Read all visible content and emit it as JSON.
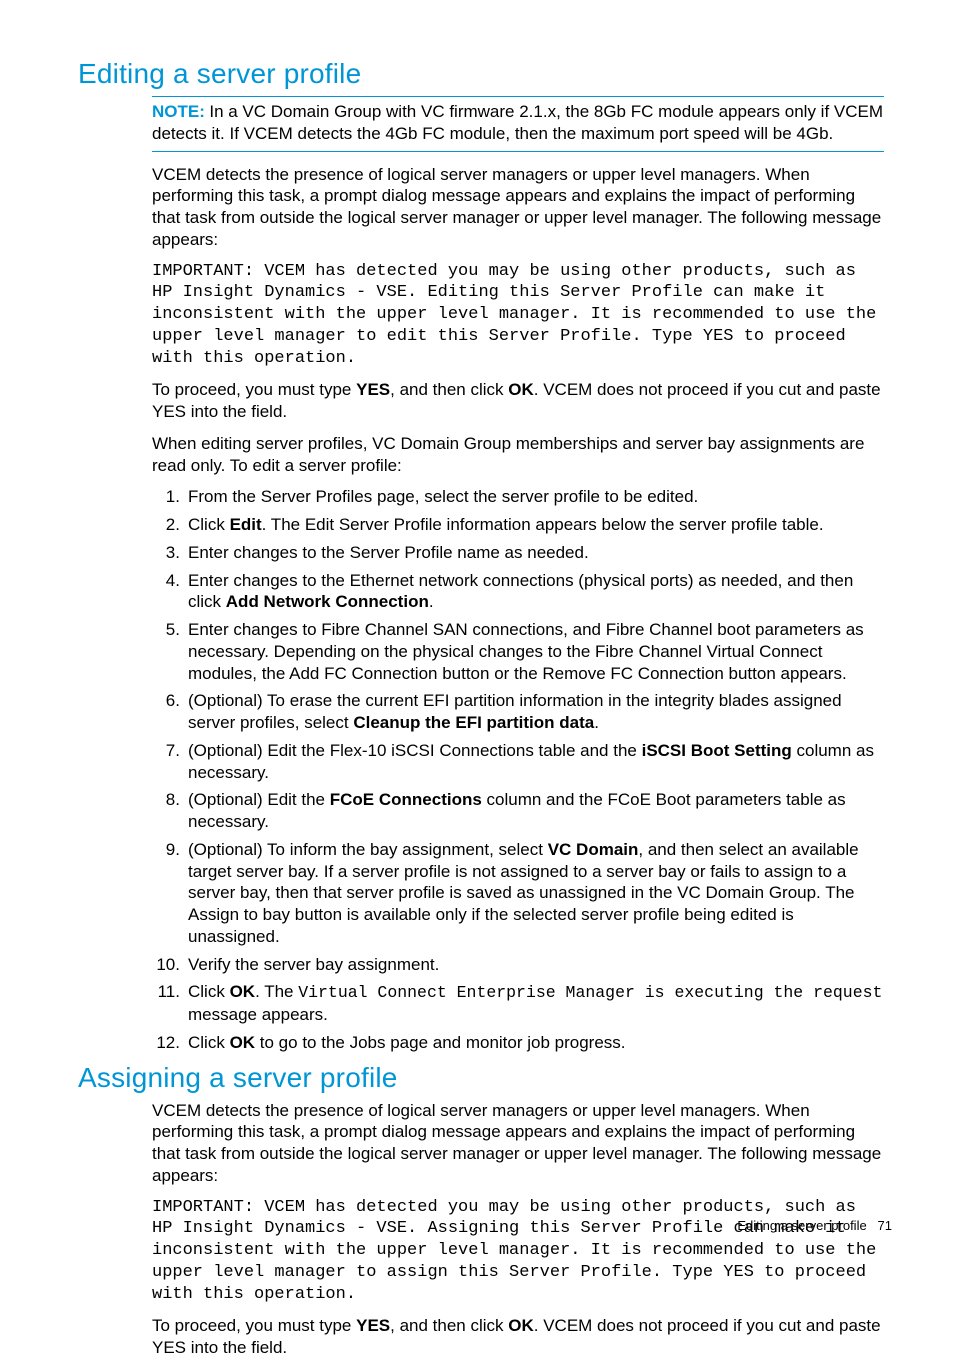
{
  "section1": {
    "title": "Editing a server profile",
    "note_label": "NOTE:",
    "note_text": "In a VC Domain Group with VC firmware 2.1.x, the 8Gb FC module appears only if VCEM detects it. If VCEM detects the 4Gb FC module, then the maximum port speed will be 4Gb.",
    "p1": "VCEM detects the presence of logical server managers or upper level managers. When performing this task, a prompt dialog message appears and explains the impact of performing that task from outside the logical server manager or upper level manager. The following message appears:",
    "important_msg": "IMPORTANT: VCEM has detected you may be using other products, such as HP Insight Dynamics - VSE. Editing this Server Profile can make it inconsistent with the upper level manager. It is recommended to use the upper level manager to edit this Server Profile. Type YES to proceed with this operation.",
    "p2_a": "To proceed, you must type ",
    "p2_b1": "YES",
    "p2_c": ", and then click ",
    "p2_b2": "OK",
    "p2_d": ". VCEM does not proceed if you cut and paste YES into the field.",
    "p3": "When editing server profiles, VC Domain Group memberships and server bay assignments are read only. To edit a server profile:",
    "steps": {
      "s1": "From the Server Profiles page, select the server profile to be edited.",
      "s2_a": "Click ",
      "s2_b": "Edit",
      "s2_c": ". The Edit Server Profile information appears below the server profile table.",
      "s3": "Enter changes to the Server Profile name as needed.",
      "s4_a": "Enter changes to the Ethernet network connections (physical ports) as needed, and then click ",
      "s4_b": "Add Network Connection",
      "s4_c": ".",
      "s5": "Enter changes to Fibre Channel SAN connections, and Fibre Channel boot parameters as necessary. Depending on the physical changes to the Fibre Channel Virtual Connect modules, the Add FC Connection button or the Remove FC Connection button appears.",
      "s6_a": "(Optional) To erase the current EFI partition information in the integrity blades assigned server profiles, select ",
      "s6_b": "Cleanup the EFI partition data",
      "s6_c": ".",
      "s7_a": "(Optional) Edit the Flex-10 iSCSI Connections table and the ",
      "s7_b": "iSCSI Boot Setting",
      "s7_c": " column as necessary.",
      "s8_a": "(Optional) Edit the ",
      "s8_b": "FCoE Connections",
      "s8_c": " column and the FCoE Boot parameters table as necessary.",
      "s9_a": "(Optional) To inform the bay assignment, select ",
      "s9_b": "VC Domain",
      "s9_c": ", and then select an available target server bay. If a server profile is not assigned to a server bay or fails to assign to a server bay, then that server profile is saved as unassigned in the VC Domain Group. The Assign to bay button is available only if the selected server profile being edited is unassigned.",
      "s10": "Verify the server bay assignment.",
      "s11_a": "Click ",
      "s11_b": "OK",
      "s11_c": ". The ",
      "s11_mono": "Virtual Connect Enterprise Manager is executing the request",
      "s11_d": " message appears.",
      "s12_a": "Click ",
      "s12_b": "OK",
      "s12_c": " to go to the Jobs page and monitor job progress."
    }
  },
  "section2": {
    "title": "Assigning a server profile",
    "p1": "VCEM detects the presence of logical server managers or upper level managers. When performing this task, a prompt dialog message appears and explains the impact of performing that task from outside the logical server manager or upper level manager. The following message appears:",
    "important_msg": "IMPORTANT: VCEM has detected you may be using other products, such as HP Insight Dynamics - VSE. Assigning this Server Profile can make it inconsistent with the upper level manager. It is recommended to use the upper level manager to assign this Server Profile. Type YES to proceed with this operation.",
    "p2_a": "To proceed, you must type ",
    "p2_b1": "YES",
    "p2_c": ", and then click ",
    "p2_b2": "OK",
    "p2_d": ". VCEM does not proceed if you cut and paste YES into the field."
  },
  "footer": {
    "text": "Editing a server profile",
    "page": "71"
  }
}
